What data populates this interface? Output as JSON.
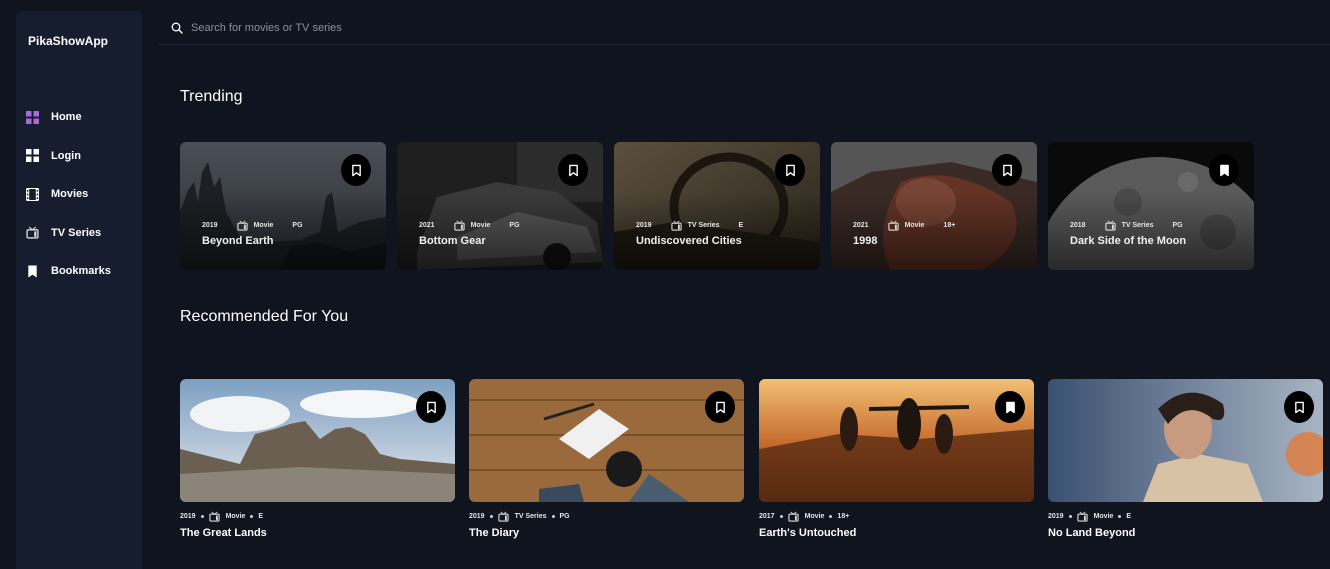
{
  "app": {
    "name": "PikaShowApp"
  },
  "search": {
    "placeholder": "Search for movies or TV series"
  },
  "nav": [
    {
      "label": "Home",
      "icon": "grid-icon",
      "active": true
    },
    {
      "label": "Login",
      "icon": "grid-icon"
    },
    {
      "label": "Movies",
      "icon": "film-icon"
    },
    {
      "label": "TV Series",
      "icon": "tv-icon"
    },
    {
      "label": "Bookmarks",
      "icon": "bookmark-icon"
    }
  ],
  "colors": {
    "accent": "#a66bd8",
    "background": "#10141e",
    "sidebar": "#161d2f"
  },
  "trending": {
    "title": "Trending",
    "items": [
      {
        "year": "2019",
        "category": "Movie",
        "rating": "PG",
        "title": "Beyond Earth",
        "bookmarked": false
      },
      {
        "year": "2021",
        "category": "Movie",
        "rating": "PG",
        "title": "Bottom Gear",
        "bookmarked": false
      },
      {
        "year": "2019",
        "category": "TV Series",
        "rating": "E",
        "title": "Undiscovered Cities",
        "bookmarked": false
      },
      {
        "year": "2021",
        "category": "Movie",
        "rating": "18+",
        "title": "1998",
        "bookmarked": false
      },
      {
        "year": "2018",
        "category": "TV Series",
        "rating": "PG",
        "title": "Dark Side of the Moon",
        "bookmarked": true
      }
    ]
  },
  "recommended": {
    "title": "Recommended For You",
    "items": [
      {
        "year": "2019",
        "category": "Movie",
        "rating": "E",
        "title": "The Great Lands",
        "bookmarked": false
      },
      {
        "year": "2019",
        "category": "TV Series",
        "rating": "PG",
        "title": "The Diary",
        "bookmarked": false
      },
      {
        "year": "2017",
        "category": "Movie",
        "rating": "18+",
        "title": "Earth's Untouched",
        "bookmarked": true
      },
      {
        "year": "2019",
        "category": "Movie",
        "rating": "E",
        "title": "No Land Beyond",
        "bookmarked": false
      }
    ]
  }
}
